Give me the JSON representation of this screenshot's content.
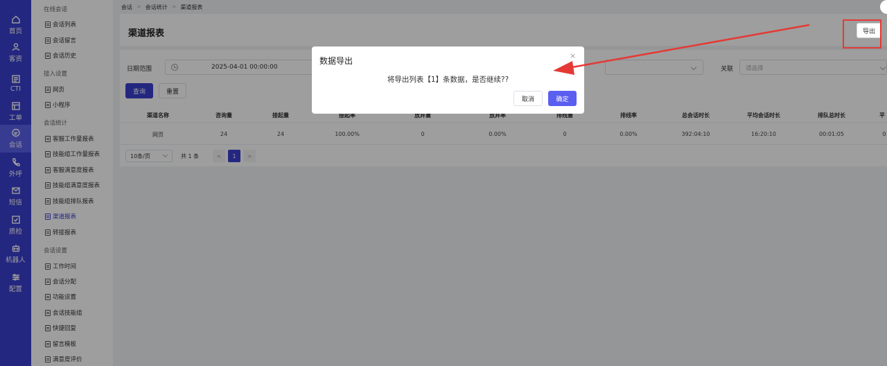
{
  "rail": {
    "items": [
      {
        "label": "首页",
        "icon": "home-icon"
      },
      {
        "label": "客资",
        "icon": "users-icon"
      },
      {
        "label": "CTI",
        "icon": "cti-icon"
      },
      {
        "label": "工单",
        "icon": "ticket-icon"
      },
      {
        "label": "会话",
        "icon": "chat-icon",
        "active": true
      },
      {
        "label": "外呼",
        "icon": "phone-icon"
      },
      {
        "label": "短信",
        "icon": "sms-icon"
      },
      {
        "label": "质检",
        "icon": "inspection-icon"
      },
      {
        "label": "机器人",
        "icon": "robot-icon"
      },
      {
        "label": "配置",
        "icon": "settings-icon"
      }
    ]
  },
  "menu": {
    "groups": [
      "在线会话",
      "接入设置",
      "会话统计",
      "会话设置"
    ],
    "items": [
      "会话列表",
      "会话留言",
      "会话历史",
      "网页",
      "小程序",
      "客服工作量报表",
      "技能组工作量报表",
      "客服满意度报表",
      "技能组满意度报表",
      "技能组排队报表",
      "渠道报表",
      "转接报表",
      "工作时间",
      "会话分配",
      "功能设置",
      "会话技能组",
      "快捷回复",
      "留言模板",
      "满意度评价"
    ],
    "active_item": "渠道报表"
  },
  "breadcrumb": [
    "会话",
    "会话统计",
    "渠道报表"
  ],
  "page": {
    "title": "渠道报表",
    "export_label": "导出"
  },
  "filters": {
    "date_label": "日期范围",
    "date_start": "2025-04-01 00:00:00",
    "relate_label": "关联",
    "relate_placeholder": "请选择",
    "query_label": "查询",
    "reset_label": "重置"
  },
  "table": {
    "columns": [
      "渠道名称",
      "咨询量",
      "接起量",
      "接起率",
      "放弃量",
      "放弃率",
      "排线量",
      "排线率",
      "总会话时长",
      "平均会话时长",
      "排队总时长",
      "平"
    ],
    "rows": [
      [
        "网页",
        "24",
        "24",
        "100.00%",
        "0",
        "0.00%",
        "0",
        "0.00%",
        "392:04:10",
        "16:20:10",
        "00:01:05",
        "0"
      ]
    ]
  },
  "pager": {
    "size_label": "10条/页",
    "total_label": "共 1 条",
    "prev": "<",
    "current": "1",
    "next": ">"
  },
  "dialog": {
    "title": "数据导出",
    "close": "×",
    "message": "将导出列表【1】条数据，是否继续??",
    "cancel_label": "取消",
    "ok_label": "确定"
  },
  "colors": {
    "brand": "#3a3fcf",
    "annotation": "#e53935"
  }
}
